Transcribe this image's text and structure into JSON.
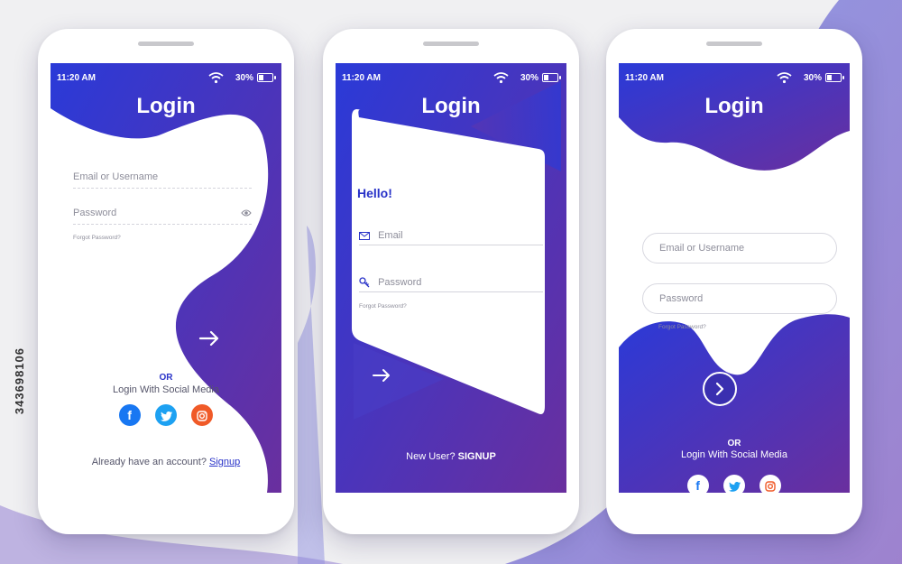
{
  "stock_id": "343698106",
  "colors": {
    "gradient_start": "#2a3ad8",
    "gradient_end": "#6a2f9e"
  },
  "phones": [
    {
      "status": {
        "time": "11:20 AM",
        "battery": "30%"
      },
      "title": "Login",
      "username_placeholder": "Email or Username",
      "password_placeholder": "Password",
      "forgot": "Forgot Password?",
      "or": "OR",
      "social_label": "Login With Social Media",
      "social_icons": [
        "facebook-icon",
        "twitter-icon",
        "instagram-icon"
      ],
      "footer_prefix": "Already have an account?",
      "footer_link": "Signup"
    },
    {
      "status": {
        "time": "11:20 AM",
        "battery": "30%"
      },
      "title": "Login",
      "greeting": "Hello!",
      "email_placeholder": "Email",
      "password_placeholder": "Password",
      "forgot": "Forgot Password?",
      "footer_prefix": "New User?",
      "footer_link": "SIGNUP"
    },
    {
      "status": {
        "time": "11:20 AM",
        "battery": "30%"
      },
      "title": "Login",
      "username_placeholder": "Email or Username",
      "password_placeholder": "Password",
      "forgot": "Forgot Password?",
      "or": "OR",
      "social_label": "Login With Social Media",
      "social_icons": [
        "facebook-icon",
        "twitter-icon",
        "instagram-icon"
      ]
    }
  ]
}
